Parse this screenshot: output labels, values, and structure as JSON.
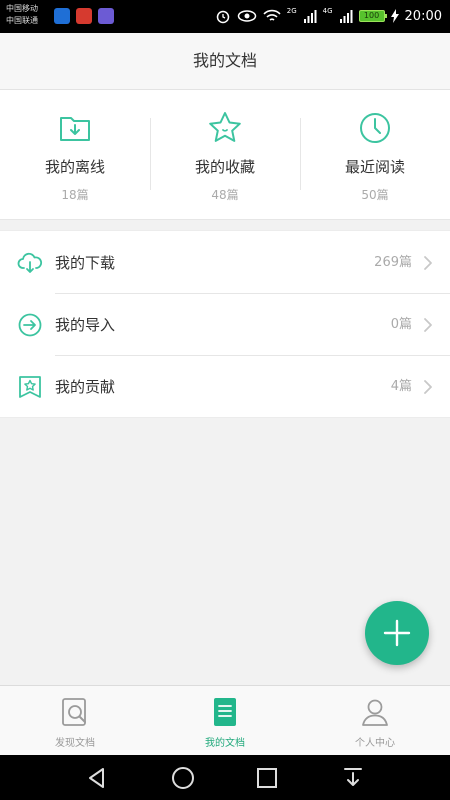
{
  "status_bar": {
    "carrier_line1": "中国移动",
    "carrier_line2": "中国联通",
    "net_2g": "2G",
    "net_4g": "4G",
    "battery": "100",
    "time": "20:00"
  },
  "header": {
    "title": "我的文档"
  },
  "stats": [
    {
      "label": "我的离线",
      "count": "18篇",
      "icon": "folder-download-icon"
    },
    {
      "label": "我的收藏",
      "count": "48篇",
      "icon": "star-icon"
    },
    {
      "label": "最近阅读",
      "count": "50篇",
      "icon": "clock-icon"
    }
  ],
  "list": [
    {
      "label": "我的下载",
      "count": "269篇",
      "icon": "cloud-download-icon"
    },
    {
      "label": "我的导入",
      "count": "0篇",
      "icon": "import-arrow-icon"
    },
    {
      "label": "我的贡献",
      "count": "4篇",
      "icon": "contribution-bookmark-icon"
    }
  ],
  "fab": {
    "icon": "plus-icon"
  },
  "bottom_nav": [
    {
      "label": "发现文档",
      "icon": "discover-search-icon",
      "active": false
    },
    {
      "label": "我的文档",
      "icon": "document-icon",
      "active": true
    },
    {
      "label": "个人中心",
      "icon": "person-icon",
      "active": false
    }
  ],
  "colors": {
    "accent": "#22b68b",
    "icon_green": "#3cc4a0",
    "muted_text": "#aaaaaa"
  }
}
